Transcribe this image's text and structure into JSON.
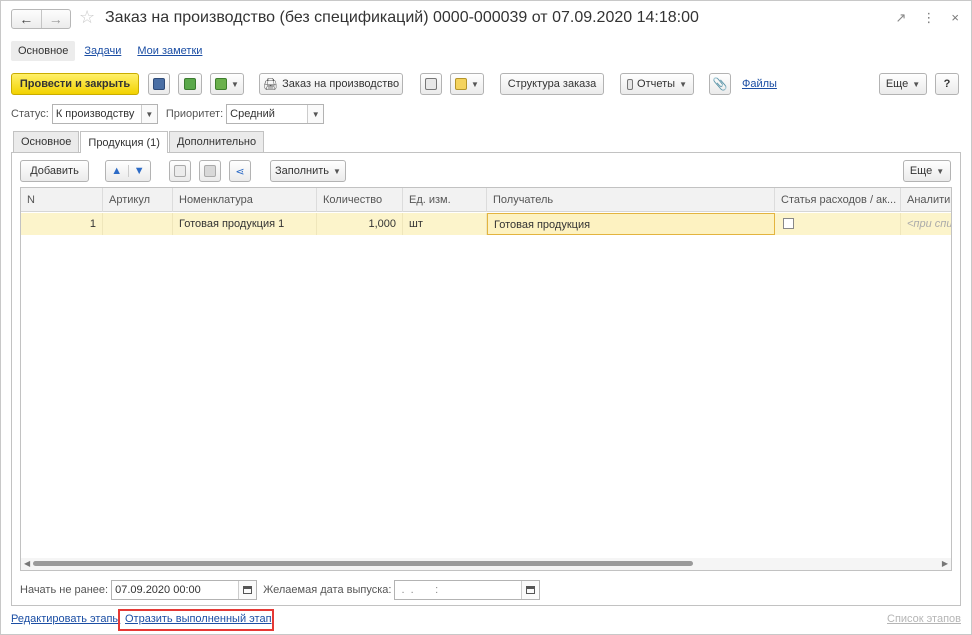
{
  "window": {
    "title": "Заказ на производство (без спецификаций) 0000-000039 от 07.09.2020 14:18:00",
    "back_icon": "←",
    "forward_icon": "→",
    "star_icon": "☆",
    "link_icon": "🔗",
    "more_icon": "⋮",
    "close_icon": "×"
  },
  "sections": {
    "main": "Основное",
    "tasks": "Задачи",
    "notes": "Мои заметки"
  },
  "toolbar": {
    "post_close": "Провести и закрыть",
    "order_print": "Заказ на производство",
    "structure": "Структура заказа",
    "reports": "Отчеты",
    "files": "Файлы",
    "more": "Еще",
    "help": "?"
  },
  "status": {
    "status_label": "Статус:",
    "status_value": "К производству",
    "priority_label": "Приоритет:",
    "priority_value": "Средний"
  },
  "tabs": {
    "main": "Основное",
    "products": "Продукция (1)",
    "extra": "Дополнительно"
  },
  "products_toolbar": {
    "add": "Добавить",
    "fill": "Заполнить",
    "more": "Еще"
  },
  "grid": {
    "columns": [
      "N",
      "Артикул",
      "Номенклатура",
      "Количество",
      "Ед. изм.",
      "Получатель",
      "Статья расходов / ак...",
      "Аналитик"
    ],
    "rows": [
      {
        "n": "1",
        "article": "",
        "item": "Готовая продукция 1",
        "qty": "1,000",
        "unit": "шт",
        "recipient": "Готовая продукция",
        "analytics": "<при спи"
      }
    ]
  },
  "dates": {
    "start_label": "Начать не ранее:",
    "start_value": "07.09.2020 00:00",
    "release_label": "Желаемая дата выпуска:",
    "release_value": " .  .       :  "
  },
  "footer": {
    "edit_stages": "Редактировать этапы",
    "reflect_stage": "Отразить выполненный этап",
    "stage_list": "Список этапов"
  }
}
